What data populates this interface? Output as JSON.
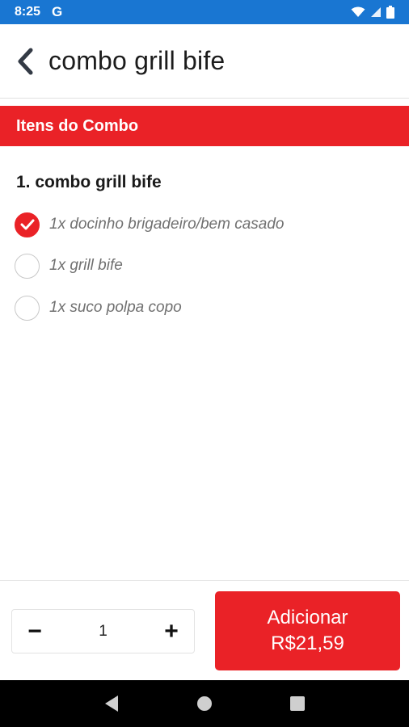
{
  "status_bar": {
    "time": "8:25",
    "g_label": "G"
  },
  "header": {
    "title": "combo grill bife"
  },
  "section": {
    "title": "Itens do Combo"
  },
  "group": {
    "title": "1. combo grill bife",
    "options": [
      {
        "label": "1x docinho brigadeiro/bem casado",
        "checked": true
      },
      {
        "label": "1x grill bife",
        "checked": false
      },
      {
        "label": "1x suco polpa copo",
        "checked": false
      }
    ]
  },
  "footer": {
    "minus_label": "−",
    "quantity": "1",
    "plus_label": "+",
    "add_label": "Adicionar",
    "price": "R$21,59"
  },
  "colors": {
    "accent": "#ea2227",
    "status_bar": "#1976d2"
  },
  "icons": {
    "back": "chevron-left-icon",
    "check": "check-icon"
  }
}
